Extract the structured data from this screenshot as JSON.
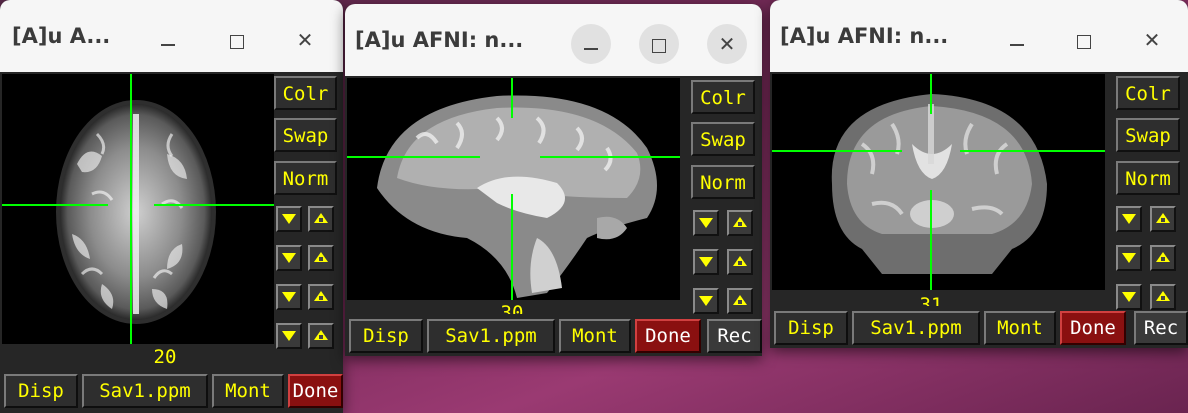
{
  "windows": [
    {
      "id": "axial",
      "title": "[A]u A...",
      "slice_number": "20",
      "side_buttons": [
        "Colr",
        "Swap",
        "Norm"
      ],
      "bottom_buttons": [
        "Disp",
        "Sav1.ppm",
        "Mont",
        "Done"
      ]
    },
    {
      "id": "sagittal",
      "title": "[A]u AFNI: n...",
      "slice_number": "30",
      "side_buttons": [
        "Colr",
        "Swap",
        "Norm"
      ],
      "bottom_buttons": [
        "Disp",
        "Sav1.ppm",
        "Mont",
        "Done",
        "Rec"
      ]
    },
    {
      "id": "coronal",
      "title": "[A]u AFNI: n...",
      "slice_number": "31",
      "side_buttons": [
        "Colr",
        "Swap",
        "Norm"
      ],
      "bottom_buttons": [
        "Disp",
        "Sav1.ppm",
        "Mont",
        "Done",
        "Rec"
      ]
    }
  ],
  "colors": {
    "button_text": "#ffff00",
    "crosshair": "#00ff00",
    "done_button": "#8a1010",
    "desktop": "#7a2a5a"
  },
  "icons": {
    "minimize": "minimize-icon",
    "maximize": "maximize-icon",
    "close": "close-icon",
    "arrow_down": "triangle-down-icon",
    "arrow_up": "triangle-up-icon"
  }
}
